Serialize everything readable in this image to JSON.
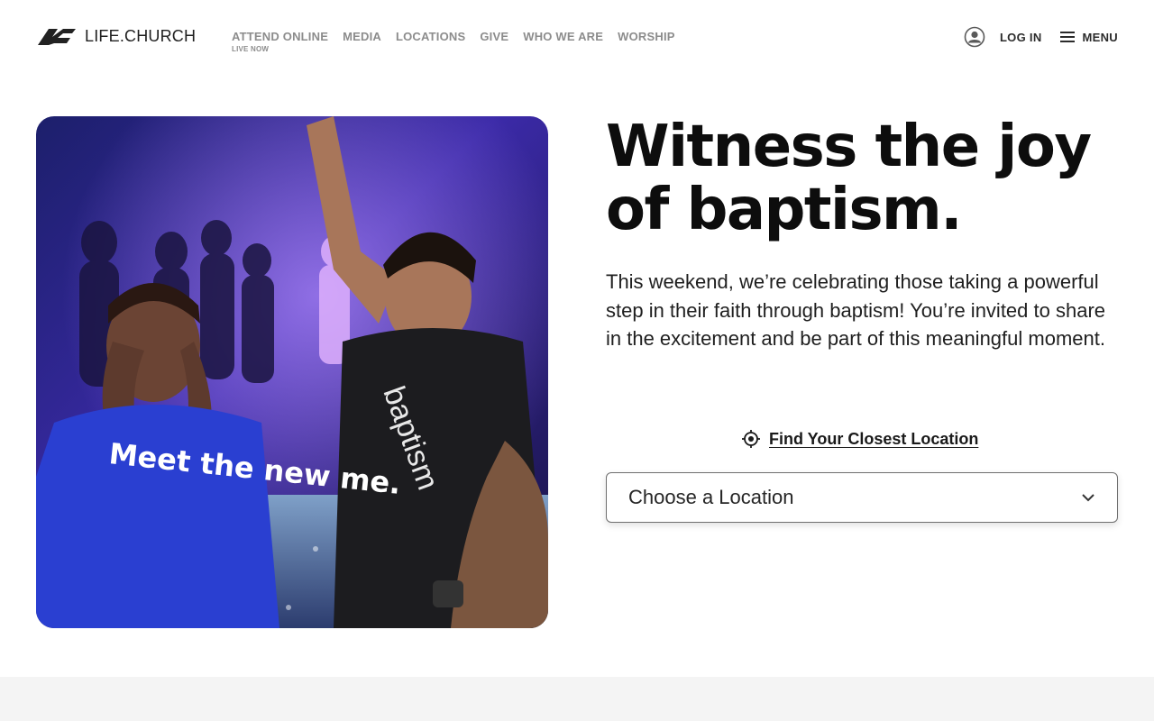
{
  "header": {
    "logo_text": "LIFE.CHURCH",
    "nav": [
      {
        "label": "ATTEND ONLINE",
        "sub": "LIVE NOW"
      },
      {
        "label": "MEDIA"
      },
      {
        "label": "LOCATIONS"
      },
      {
        "label": "GIVE"
      },
      {
        "label": "WHO WE ARE"
      },
      {
        "label": "WORSHIP"
      }
    ],
    "login_label": "LOG IN",
    "menu_label": "MENU",
    "icons": {
      "login": "user-circle-icon",
      "menu": "hamburger-icon"
    }
  },
  "hero": {
    "photo_shirt_text": "Meet the new me.",
    "photo_shirt_brand": "baptism",
    "headline_line1": "Witness the joy",
    "headline_line2": "of baptism.",
    "intro": "This weekend, we’re celebrating those taking a powerful step in their faith through baptism! You’re invited to share in the excitement and be part of this meaningful moment.",
    "find_location_label": "Find Your Closest Location",
    "location_select_label": "Choose a Location",
    "icons": {
      "find": "crosshair-icon",
      "select": "chevron-down-icon"
    }
  },
  "colors": {
    "text_dark": "#0d0d0d",
    "nav_gray": "#8c8c8c",
    "footer_band": "#f4f4f4",
    "photo_purple": "#3b2aa8",
    "shirt_blue": "#2a3fd1"
  }
}
